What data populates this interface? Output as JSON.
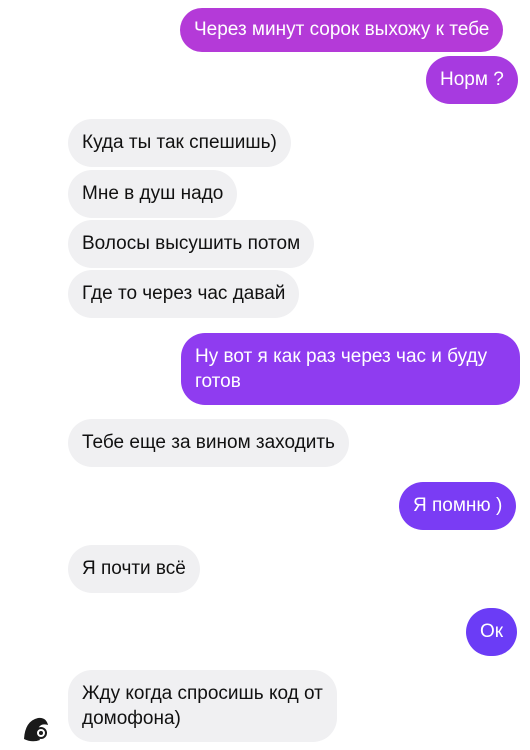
{
  "messages": [
    {
      "side": "out",
      "text": "Через минут сорок выхожу к тебе"
    },
    {
      "side": "out",
      "text": "Норм ?"
    },
    {
      "side": "in",
      "text": "Куда ты так спешишь)"
    },
    {
      "side": "in",
      "text": "Мне в душ надо"
    },
    {
      "side": "in",
      "text": "Волосы высушить потом"
    },
    {
      "side": "in",
      "text": "Где то через час давай"
    },
    {
      "side": "out",
      "lines": [
        "Ну вот я как раз через час и буду",
        "готов"
      ]
    },
    {
      "side": "in",
      "text": "Тебе еще за вином заходить"
    },
    {
      "side": "out",
      "text": "Я помню )"
    },
    {
      "side": "in",
      "text": "Я почти всё"
    },
    {
      "side": "out",
      "text": "Ок"
    },
    {
      "side": "in",
      "lines": [
        "Жду когда спросишь код от",
        "домофона)"
      ]
    }
  ],
  "colors": {
    "outgoing_top": "#b43ad8",
    "outgoing_mid": "#8f3cf0",
    "outgoing_bottom": "#6b3cf6",
    "incoming_bg": "#f0f0f2"
  },
  "avatar": {
    "icon": "contact-avatar-icon"
  }
}
